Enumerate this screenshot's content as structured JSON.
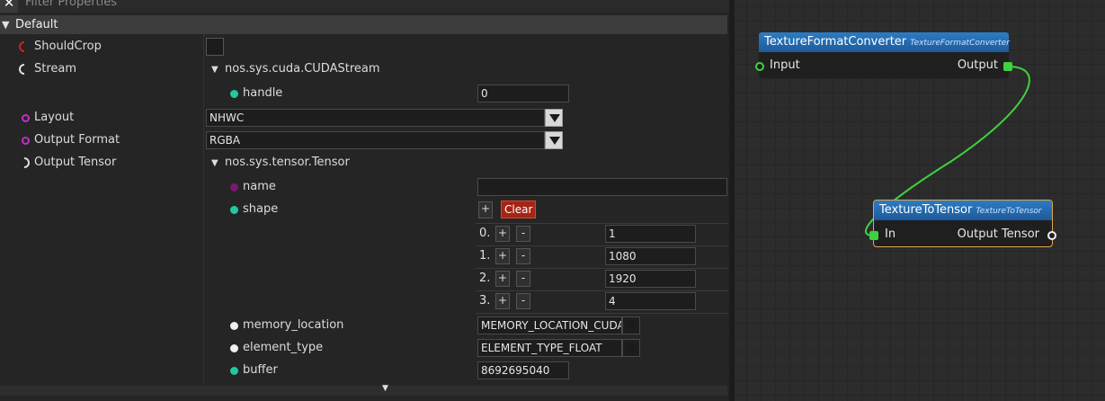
{
  "properties": {
    "filter_placeholder": "Filter Properties",
    "section_title": "Default",
    "rows": {
      "should_crop": {
        "label": "ShouldCrop",
        "checked": false
      },
      "stream": {
        "label": "Stream",
        "type_label": "nos.sys.cuda.CUDAStream",
        "handle": {
          "label": "handle",
          "value": "0"
        }
      },
      "layout": {
        "label": "Layout",
        "value": "NHWC"
      },
      "output_format": {
        "label": "Output Format",
        "value": "RGBA"
      },
      "output_tensor": {
        "label": "Output Tensor",
        "type_label": "nos.sys.tensor.Tensor",
        "name": {
          "label": "name",
          "value": ""
        },
        "shape": {
          "label": "shape",
          "add_label": "+",
          "clear_label": "Clear",
          "items": [
            {
              "index": "0.",
              "plus": "+",
              "minus": "-",
              "value": "1"
            },
            {
              "index": "1.",
              "plus": "+",
              "minus": "-",
              "value": "1080"
            },
            {
              "index": "2.",
              "plus": "+",
              "minus": "-",
              "value": "1920"
            },
            {
              "index": "3.",
              "plus": "+",
              "minus": "-",
              "value": "4"
            }
          ]
        },
        "memory_location": {
          "label": "memory_location",
          "value": "MEMORY_LOCATION_CUDA"
        },
        "element_type": {
          "label": "element_type",
          "value": "ELEMENT_TYPE_FLOAT"
        },
        "buffer": {
          "label": "buffer",
          "value": "8692695040"
        }
      }
    }
  },
  "graph": {
    "nodes": [
      {
        "title": "TextureFormatConverter",
        "subtitle": "TextureFormatConverter",
        "input_label": "Input",
        "output_label": "Output"
      },
      {
        "title": "TextureToTensor",
        "subtitle": "TextureToTensor",
        "input_label": "In",
        "output_label": "Output Tensor"
      }
    ],
    "link_color": "#3fd13f"
  },
  "colors": {
    "pin_teal": "#22c9a0",
    "pin_magenta": "#c030c0",
    "pin_dark_magenta": "#7a1a6e",
    "pin_red": "#d02020",
    "clear_button": "#a62416",
    "node_header": "#2c7cc4",
    "node_selected_border": "#e0a64a"
  },
  "icons": {
    "close": "close-icon",
    "collapse": "chevron-down-icon"
  }
}
